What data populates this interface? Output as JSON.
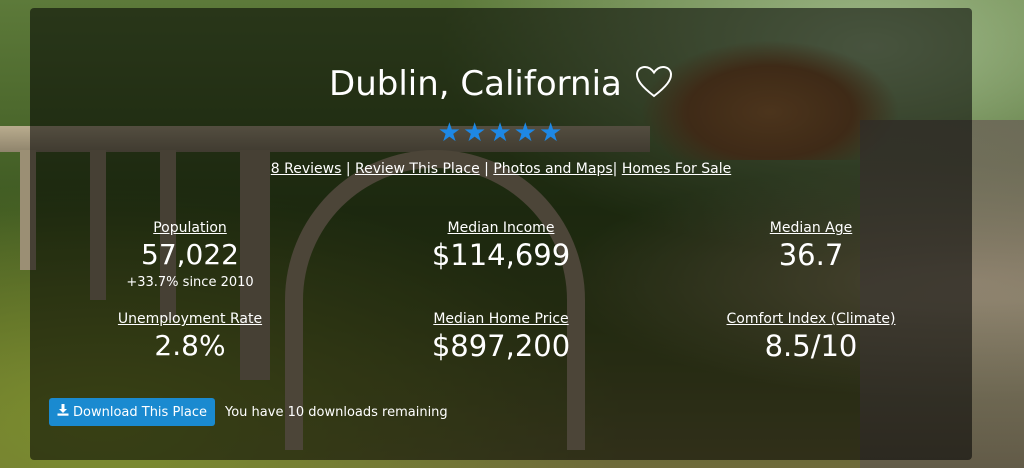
{
  "header": {
    "title": "Dublin, California",
    "favorite_icon": "heart-outline-icon",
    "rating_stars": 5,
    "star_color": "#1e88e5"
  },
  "links": {
    "reviews": "8 Reviews",
    "review_place": "Review This Place",
    "photos_maps": "Photos and Maps",
    "homes_for_sale": "Homes For Sale"
  },
  "stats": {
    "population": {
      "label": "Population",
      "value": "57,022",
      "sub": "+33.7% since 2010"
    },
    "median_income": {
      "label": "Median Income",
      "value": "$114,699"
    },
    "median_age": {
      "label": "Median Age",
      "value": "36.7"
    },
    "unemployment": {
      "label": "Unemployment Rate",
      "value": "2.8%"
    },
    "median_home_price": {
      "label": "Median Home Price",
      "value": "$897,200"
    },
    "comfort_index": {
      "label": "Comfort Index (Climate)",
      "value": "8.5/10"
    }
  },
  "download": {
    "button_label": "Download This Place",
    "icon": "download-icon",
    "remaining_text": "You have 10 downloads remaining",
    "button_color": "#1a8ad0"
  }
}
